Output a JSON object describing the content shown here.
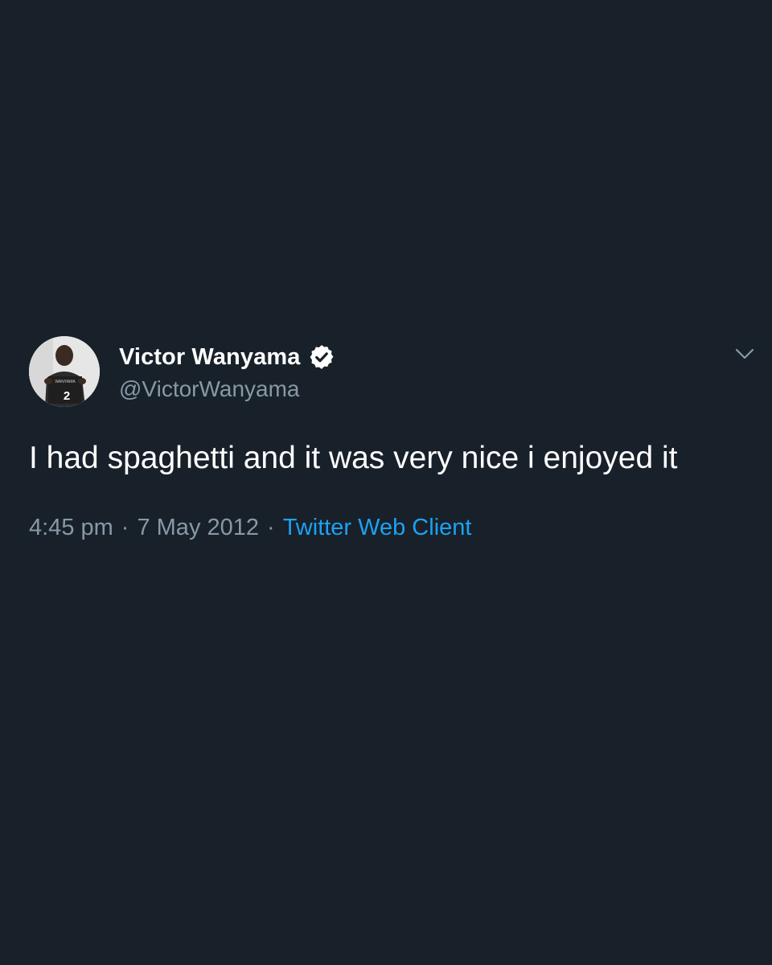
{
  "user": {
    "display_name": "Victor Wanyama",
    "handle": "@VictorWanyama",
    "avatar_jersey_number": "2",
    "avatar_jersey_name": "WANYAMA"
  },
  "tweet": {
    "text": "I had spaghetti and it was very nice i enjoyed it",
    "time": "4:45 pm",
    "separator": "·",
    "date": "7 May 2012",
    "source": "Twitter Web Client"
  },
  "icons": {
    "verified": "verified-badge-icon",
    "menu": "chevron-down-icon"
  },
  "colors": {
    "background": "#18202a",
    "text_primary": "#ffffff",
    "text_secondary": "#8899a6",
    "link": "#1da1f2"
  }
}
